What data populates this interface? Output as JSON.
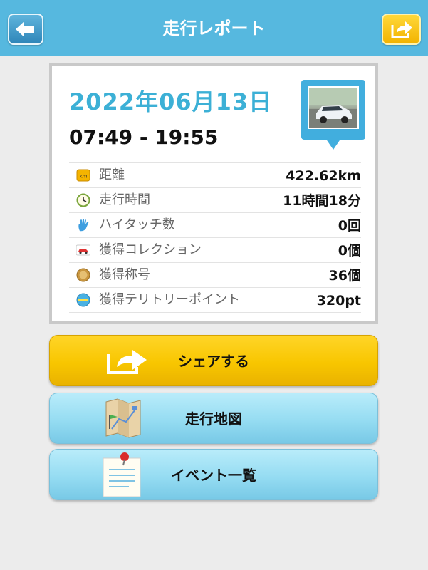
{
  "header": {
    "title": "走行レポート",
    "back_icon": "arrow-left-icon",
    "share_icon": "share-arrow-icon"
  },
  "report": {
    "date": "2022年06月13日",
    "time_range": "07:49 - 19:55",
    "photo_icon": "car-photo-pin-icon",
    "stats": [
      {
        "icon": "km-badge-icon",
        "label": "距離",
        "value": "422.62km"
      },
      {
        "icon": "clock-icon",
        "label": "走行時間",
        "value": "11時間18分"
      },
      {
        "icon": "hand-icon",
        "label": "ハイタッチ数",
        "value": "0回"
      },
      {
        "icon": "car-icon",
        "label": "獲得コレクション",
        "value": "0個"
      },
      {
        "icon": "medal-icon",
        "label": "獲得称号",
        "value": "36個"
      },
      {
        "icon": "spot-badge-icon",
        "label": "獲得テリトリーポイント",
        "value": "320pt"
      }
    ]
  },
  "actions": {
    "share_label": "シェアする",
    "map_label": "走行地図",
    "events_label": "イベント一覧"
  },
  "colors": {
    "header_bg": "#56b8df",
    "date_text": "#3cb0d6",
    "share_button": "#f8c600",
    "secondary_button": "#95dcf2"
  }
}
